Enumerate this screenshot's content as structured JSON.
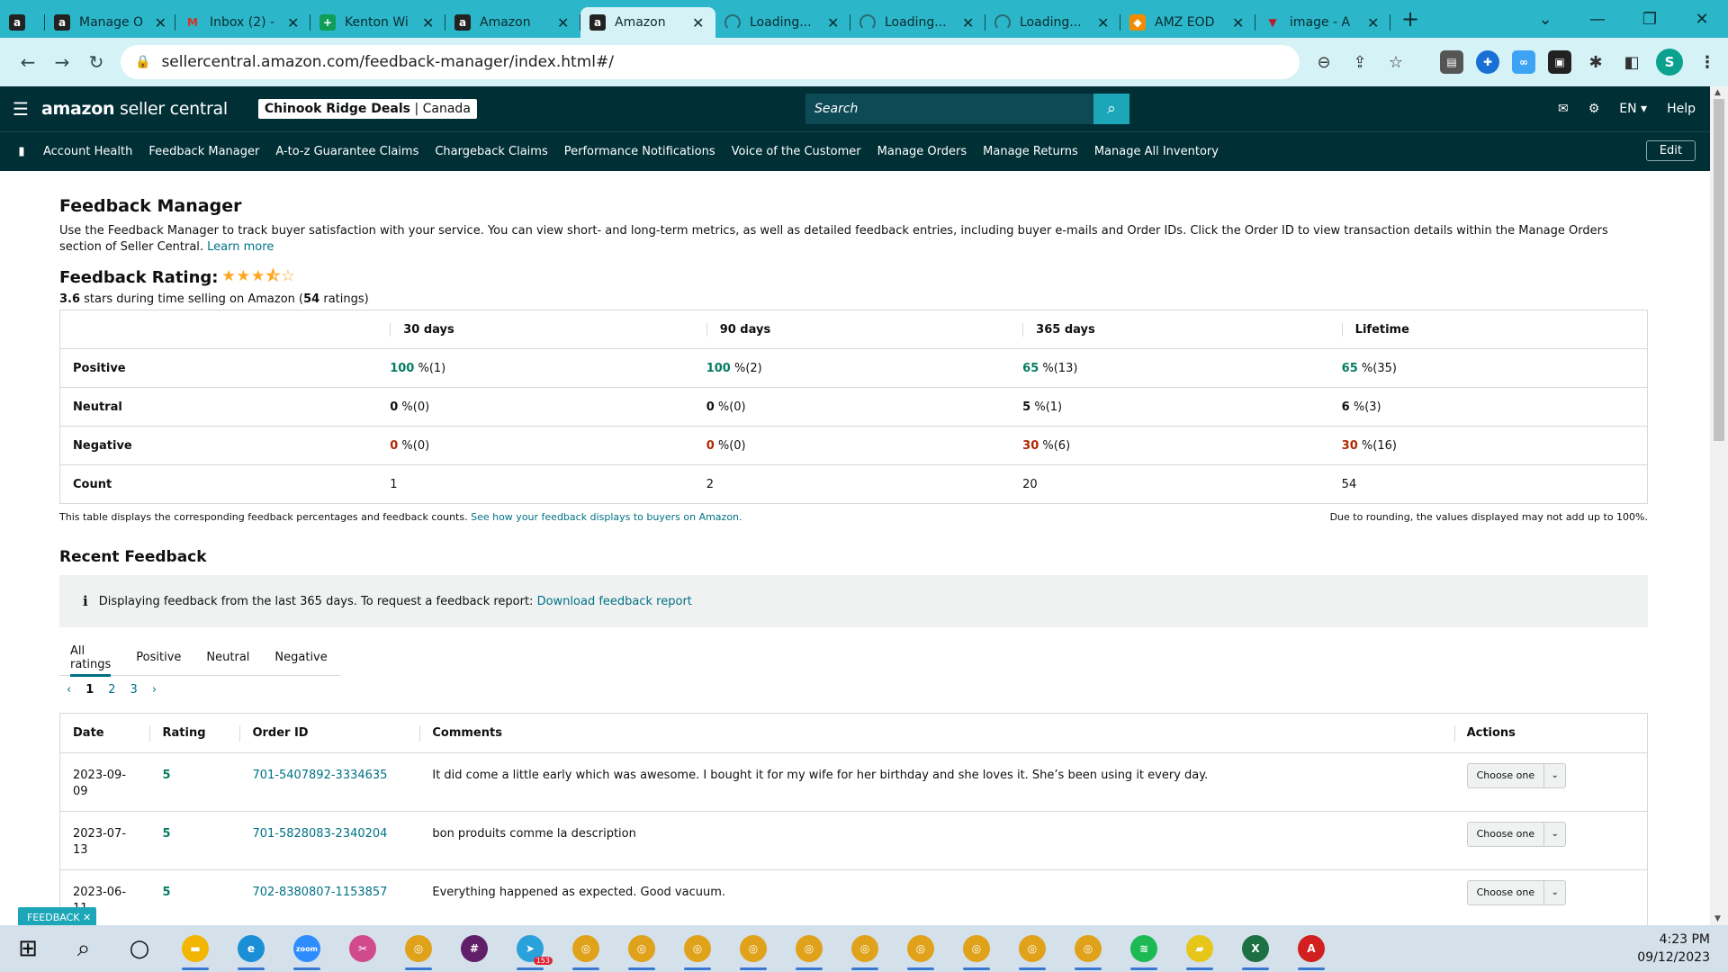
{
  "browser": {
    "tabs": [
      {
        "title": "",
        "favicon": "amazon-a",
        "color": "#111111"
      },
      {
        "title": "Manage O",
        "favicon": "amazon-a",
        "color": "#111111"
      },
      {
        "title": "Inbox (2) -",
        "favicon": "gmail-m",
        "color": "#d93025"
      },
      {
        "title": "Kenton Wi",
        "favicon": "sheets-plus",
        "color": "#0f9d58"
      },
      {
        "title": "Amazon",
        "favicon": "amazon-a",
        "color": "#111111"
      },
      {
        "title": "Amazon",
        "favicon": "amazon-a",
        "color": "#111111",
        "active": true
      },
      {
        "title": "Loading...",
        "favicon": "spinner",
        "color": "#2a6a74"
      },
      {
        "title": "Loading...",
        "favicon": "spinner",
        "color": "#2a6a74"
      },
      {
        "title": "Loading...",
        "favicon": "spinner",
        "color": "#2a6a74"
      },
      {
        "title": "AMZ EOD",
        "favicon": "colorful-logo",
        "color": "#f28b00"
      },
      {
        "title": "image - A",
        "favicon": "triangle-logo",
        "color": "#c0192d"
      }
    ],
    "url": "sellercentral.amazon.com/feedback-manager/index.html#/",
    "profile_initial": "S"
  },
  "seller_central": {
    "logo_main": "amazon",
    "logo_sub": " seller central",
    "account_name": "Chinook Ridge Deals",
    "account_region": "Canada",
    "search_placeholder": "Search",
    "lang": "EN",
    "help": "Help",
    "nav": [
      "Account Health",
      "Feedback Manager",
      "A-to-z Guarantee Claims",
      "Chargeback Claims",
      "Performance Notifications",
      "Voice of the Customer",
      "Manage Orders",
      "Manage Returns",
      "Manage All Inventory"
    ],
    "edit": "Edit"
  },
  "feedback": {
    "title": "Feedback Manager",
    "description": "Use the Feedback Manager to track buyer satisfaction with your service. You can view short- and long-term metrics, as well as detailed feedback entries, including buyer e-mails and Order IDs. Click the Order ID to view transaction details within the Manage Orders section of Seller Central.",
    "learn_more": "Learn more",
    "rating_label": "Feedback Rating:",
    "rating_value": 3.6,
    "rating_stars_text": "★★★⯪☆",
    "rating_sub_value": "3.6",
    "rating_sub_mid": " stars during time selling on Amazon (",
    "rating_sub_count": "54",
    "rating_sub_end": " ratings)",
    "periods": [
      "30 days",
      "90 days",
      "365 days",
      "Lifetime"
    ],
    "rows": [
      {
        "label": "Positive",
        "cells": [
          [
            "100",
            " %(1)"
          ],
          [
            "100",
            " %(2)"
          ],
          [
            "65",
            " %(13)"
          ],
          [
            "65",
            " %(35)"
          ]
        ]
      },
      {
        "label": "Neutral",
        "cells": [
          [
            "0",
            " %(0)"
          ],
          [
            "0",
            " %(0)"
          ],
          [
            "5",
            " %(1)"
          ],
          [
            "6",
            " %(3)"
          ]
        ]
      },
      {
        "label": "Negative",
        "cells": [
          [
            "0",
            " %(0)"
          ],
          [
            "0",
            " %(0)"
          ],
          [
            "30",
            " %(6)"
          ],
          [
            "30",
            " %(16)"
          ]
        ]
      },
      {
        "label": "Count",
        "cells": [
          [
            "1",
            ""
          ],
          [
            "2",
            ""
          ],
          [
            "20",
            ""
          ],
          [
            "54",
            ""
          ]
        ]
      }
    ],
    "table_note": "This table displays the corresponding feedback percentages and feedback counts.",
    "table_note_link": "See how your feedback displays to buyers on Amazon.",
    "rounding_note": "Due to rounding, the values displayed may not add up to 100%.",
    "recent_title": "Recent Feedback",
    "info_text": "Displaying feedback from the last 365 days. To request a feedback report:",
    "info_link": "Download feedback report",
    "filter_tabs": [
      "All ratings",
      "Positive",
      "Neutral",
      "Negative"
    ],
    "pages": [
      "1",
      "2",
      "3"
    ],
    "columns": [
      "Date",
      "Rating",
      "Order ID",
      "Comments",
      "Actions"
    ],
    "entries": [
      {
        "date": "2023-09-09",
        "rating": "5",
        "order_id": "701-5407892-3334635",
        "comment": "It did come a little early which was awesome. I bought it for my wife for her birthday and she loves it. She’s been using it every day.",
        "action": "Choose one"
      },
      {
        "date": "2023-07-13",
        "rating": "5",
        "order_id": "701-5828083-2340204",
        "comment": "bon produits comme la description",
        "action": "Choose one"
      },
      {
        "date": "2023-06-11",
        "rating": "5",
        "order_id": "702-8380807-1153857",
        "comment": "Everything happened as expected. Good vacuum.",
        "action": "Choose one"
      }
    ],
    "feedback_pill": "FEEDBACK"
  },
  "taskbar": {
    "icons": [
      "windows-start-icon",
      "search-icon",
      "task-view-icon",
      "file-explorer-icon",
      "edge-icon",
      "zoom-icon",
      "snipping-tool-icon",
      "chrome-icon",
      "slack-icon",
      "telegram-icon",
      "chrome-icon",
      "chrome-icon",
      "chrome-icon",
      "chrome-icon",
      "chrome-icon",
      "chrome-icon",
      "chrome-icon",
      "chrome-icon",
      "chrome-icon",
      "chrome-icon",
      "spotify-icon",
      "sticky-notes-icon",
      "excel-icon",
      "acrobat-icon"
    ],
    "telegram_badge": "153",
    "time": "4:23 PM",
    "date": "09/12/2023"
  }
}
